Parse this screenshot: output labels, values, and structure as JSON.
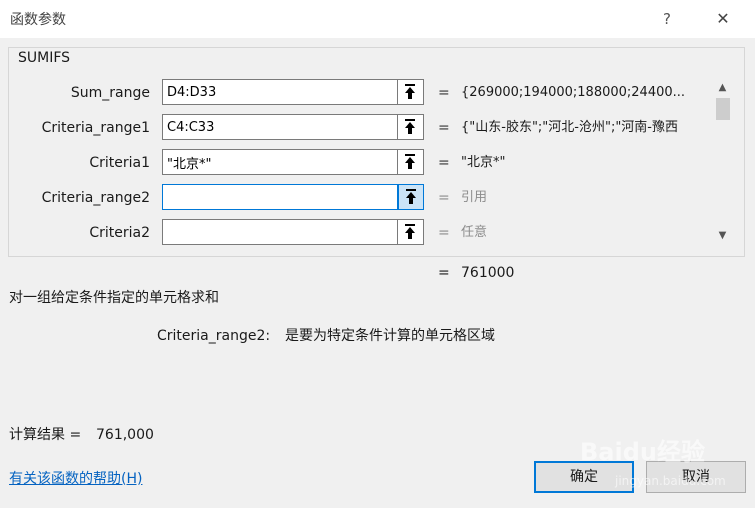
{
  "window": {
    "title": "函数参数",
    "help_glyph": "?",
    "close_glyph": "✕"
  },
  "function_name": "SUMIFS",
  "args": [
    {
      "label": "Sum_range",
      "value": "D4:D33",
      "result": "{269000;194000;188000;24400..."
    },
    {
      "label": "Criteria_range1",
      "value": "C4:C33",
      "result": "{\"山东-胶东\";\"河北-沧州\";\"河南-豫西"
    },
    {
      "label": "Criteria1",
      "value": "\"北京*\"",
      "result": "\"北京*\""
    },
    {
      "label": "Criteria_range2",
      "value": "",
      "result": "引用"
    },
    {
      "label": "Criteria2",
      "value": "",
      "result": "任意"
    }
  ],
  "equals_sign": "=",
  "overall_result": "761000",
  "description": "对一组给定条件指定的单元格求和",
  "arg_help": {
    "name": "Criteria_range2:",
    "text": "是要为特定条件计算的单元格区域"
  },
  "calc": {
    "label": "计算结果 =",
    "value": "761,000"
  },
  "help_link": "有关该函数的帮助(H)",
  "buttons": {
    "ok": "确定",
    "cancel": "取消"
  },
  "watermark": {
    "main": "Baidu经验",
    "sub": "jingyan.baidu.com"
  }
}
